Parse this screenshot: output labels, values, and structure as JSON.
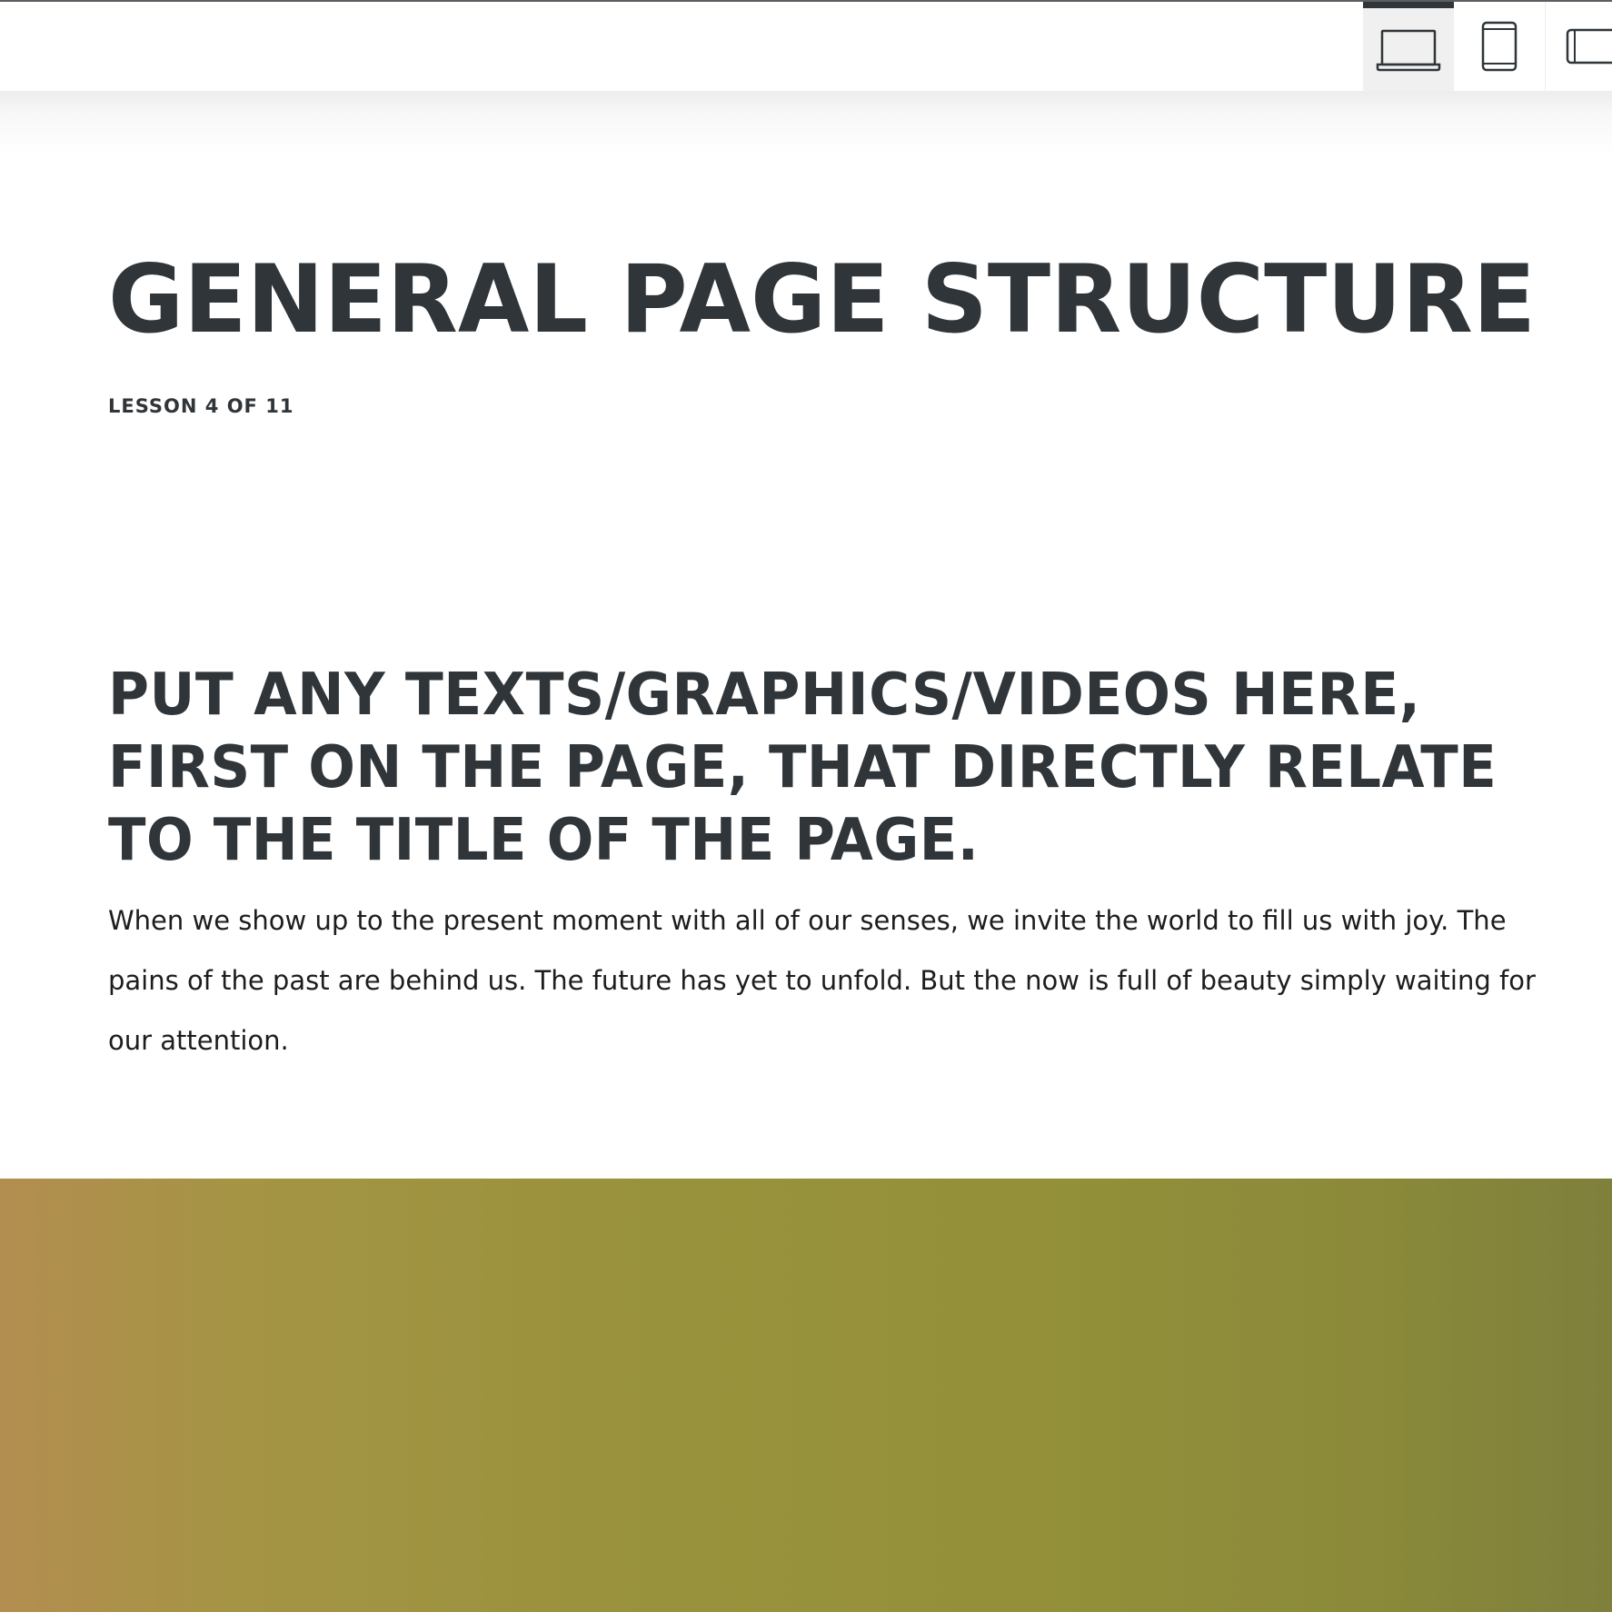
{
  "toolbar": {
    "devices": [
      {
        "name": "desktop",
        "icon": "laptop-icon",
        "active": true
      },
      {
        "name": "tablet",
        "icon": "tablet-icon",
        "active": false
      },
      {
        "name": "mobile-landscape",
        "icon": "phone-landscape-icon",
        "active": false
      }
    ],
    "active_indicator_color": "#2f3539"
  },
  "lesson": {
    "title": "GENERAL PAGE STRUCTURE",
    "progress_label": "LESSON 4 OF 11"
  },
  "section": {
    "heading_lines": [
      "PUT ANY TEXTS/GRAPHICS/VIDEOS HERE,",
      "FIRST ON THE PAGE, THAT DIRECTLY RELATE",
      "TO THE TITLE OF THE PAGE."
    ],
    "body_lines": [
      "When we show up to the present moment with all of our senses, we invite the world to fill us with joy. The",
      "pains of the past are behind us. The future has yet to unfold. But the now is full of beauty simply waiting for",
      "our attention."
    ]
  },
  "colors": {
    "text_dark": "#2f3539",
    "band_left": "#b38e50",
    "band_mid": "#99923c",
    "band_right": "#7e803c"
  }
}
